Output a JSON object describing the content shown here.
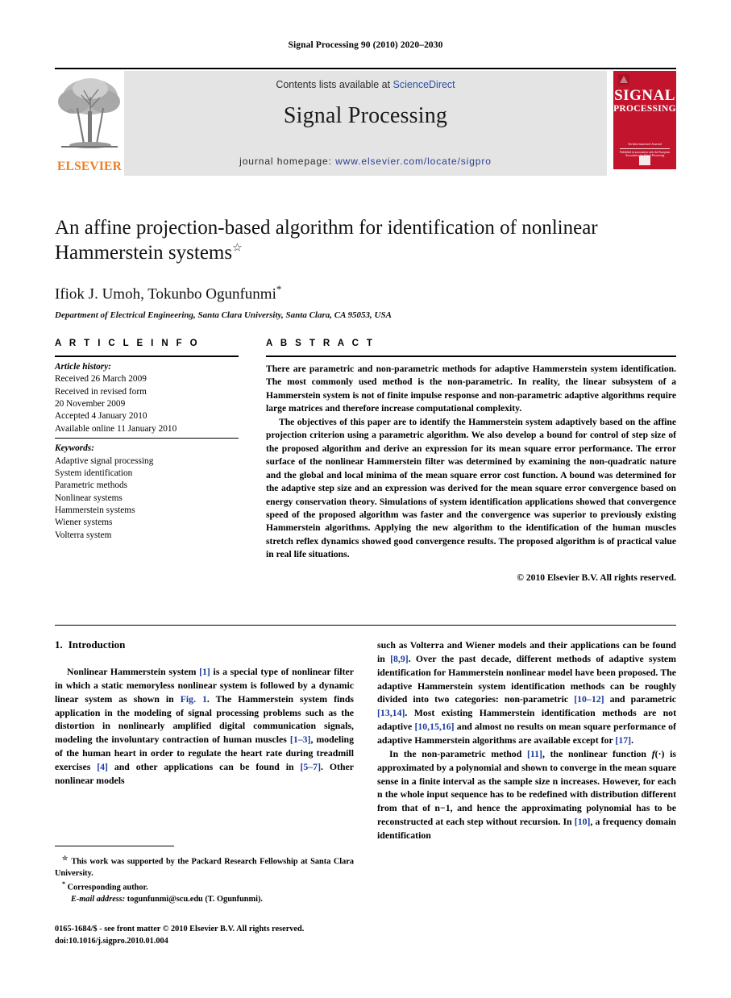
{
  "running_head": "Signal Processing 90 (2010) 2020–2030",
  "masthead": {
    "contents_prefix": "Contents lists available at ",
    "sciencedirect": "ScienceDirect",
    "journal_title": "Signal Processing",
    "homepage_prefix": "journal homepage: ",
    "homepage_url": "www.elsevier.com/locate/sigpro",
    "publisher_wordmark": "ELSEVIER",
    "publisher_accent_color": "#F07C21",
    "cover": {
      "line1": "SIGNAL",
      "line2": "PROCESSING",
      "tagline": "An International Journal",
      "subtagline": "Published in association with the European Association for Signal Processing",
      "color": "#c3142d"
    }
  },
  "article": {
    "title": "An affine projection-based algorithm for identification of nonlinear Hammerstein systems",
    "title_footnote_mark": "☆",
    "authors": "Ifiok J. Umoh, Tokunbo Ogunfunmi",
    "author_footnote_mark": "*",
    "affiliation": "Department of Electrical Engineering, Santa Clara University, Santa Clara, CA 95053, USA"
  },
  "article_info": {
    "label": "A R T I C L E   I N F O",
    "history_title": "Article history:",
    "history": [
      "Received 26 March 2009",
      "Received in revised form",
      "20 November 2009",
      "Accepted 4 January 2010",
      "Available online 11 January 2010"
    ],
    "keywords_title": "Keywords:",
    "keywords": [
      "Adaptive signal processing",
      "System identification",
      "Parametric methods",
      "Nonlinear systems",
      "Hammerstein systems",
      "Wiener systems",
      "Volterra system"
    ]
  },
  "abstract": {
    "label": "A B S T R A C T",
    "paragraphs": [
      "There are parametric and non-parametric methods for adaptive Hammerstein system identification. The most commonly used method is the non-parametric. In reality, the linear subsystem of a Hammerstein system is not of finite impulse response and non-parametric adaptive algorithms require large matrices and therefore increase computational complexity.",
      "The objectives of this paper are to identify the Hammerstein system adaptively based on the affine projection criterion using a parametric algorithm. We also develop a bound for control of step size of the proposed algorithm and derive an expression for its mean square error performance. The error surface of the nonlinear Hammerstein filter was determined by examining the non-quadratic nature and the global and local minima of the mean square error cost function. A bound was determined for the adaptive step size and an expression was derived for the mean square error convergence based on energy conservation theory. Simulations of system identification applications showed that convergence speed of the proposed algorithm was faster and the convergence was superior to previously existing Hammerstein algorithms. Applying the new algorithm to the identification of the human muscles stretch reflex dynamics showed good convergence results. The proposed algorithm is of practical value in real life situations."
    ],
    "copyright": "© 2010 Elsevier B.V. All rights reserved."
  },
  "body": {
    "section_number": "1.",
    "section_title": "Introduction",
    "left_column_html": "Nonlinear Hammerstein system <span class=\"ref\">[1]</span> is a special type of nonlinear filter in which a static memoryless nonlinear system is followed by a dynamic linear system as shown in <span class=\"ref\">Fig. 1</span>. The Hammerstein system finds application in the modeling of signal processing problems such as the distortion in nonlinearly amplified digital communication signals, modeling the involuntary contraction of human muscles <span class=\"ref\">[1–3]</span>, modeling of the human heart in order to regulate the heart rate during treadmill exercises <span class=\"ref\">[4]</span> and other applications can be found in <span class=\"ref\">[5–7]</span>. Other nonlinear models",
    "right_column_html_1": "such as Volterra and Wiener models and their applications can be found in <span class=\"ref\">[8,9]</span>. Over the past decade, different methods of adaptive system identification for Hammerstein nonlinear model have been proposed. The adaptive Hammerstein system identification methods can be roughly divided into two categories: non-parametric <span class=\"ref\">[10–12]</span> and parametric <span class=\"ref\">[13,14]</span>. Most existing Hammerstein identification methods are not adaptive <span class=\"ref\">[10,15,16]</span> and almost no results on mean square performance of adaptive Hammerstein algorithms are available except for <span class=\"ref\">[17]</span>.",
    "right_column_html_2": "In the non-parametric method <span class=\"ref\">[11]</span>, the nonlinear function <i>f</i>(·) is approximated by a polynomial and shown to converge in the mean square sense in a finite interval as the sample size n increases. However, for each n the whole input sequence has to be redefined with distribution different from that of n−1, and hence the approximating polynomial has to be reconstructed at each step without recursion. In <span class=\"ref\">[10]</span>, a frequency domain identification"
  },
  "footnotes": {
    "funding_mark": "☆",
    "funding": "This work was supported by the Packard Research Fellowship at Santa Clara University.",
    "corresponding_mark": "*",
    "corresponding": "Corresponding author.",
    "email_label": "E-mail address:",
    "email": "togunfunmi@scu.edu (T. Ogunfunmi)."
  },
  "imprint": {
    "line1": "0165-1684/$ - see front matter © 2010 Elsevier B.V. All rights reserved.",
    "line2": "doi:10.1016/j.sigpro.2010.01.004"
  }
}
